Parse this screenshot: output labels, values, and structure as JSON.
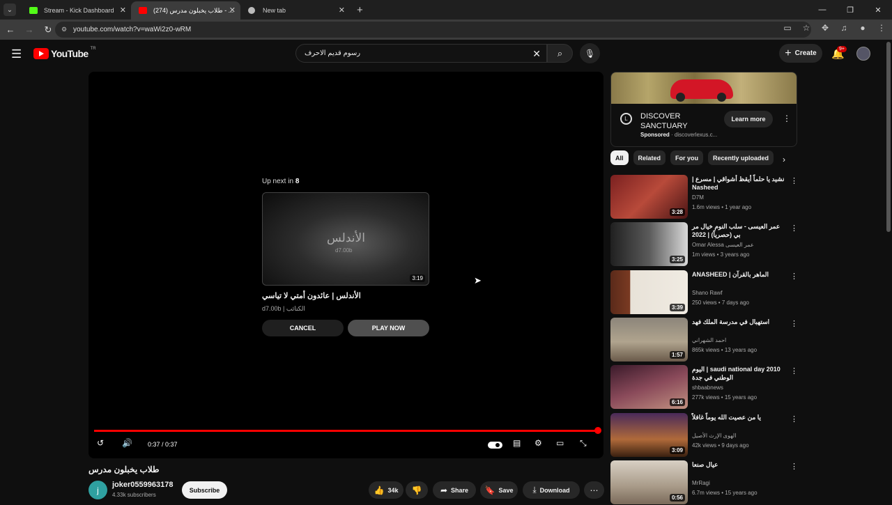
{
  "browser": {
    "tabs": [
      {
        "title": "Stream - Kick Dashboard",
        "fav_color": "#53fc18"
      },
      {
        "title": "طلاب يخبلون مدرس (274) - ...",
        "fav_color": "#ff0000"
      },
      {
        "title": "New tab",
        "fav_color": "#bbbbbb"
      }
    ],
    "url": "youtube.com/watch?v=waWi2z0-wRM"
  },
  "youtube": {
    "logo_text": "YouTube",
    "country": "TR",
    "search_value": "رسوم قديم الاحرف",
    "create_label": "Create",
    "notif_badge": "9+"
  },
  "player": {
    "upnext_prefix": "Up next in",
    "upnext_seconds": "8",
    "next_thumb_text": "الأندلس",
    "next_thumb_sub": "d7.00b",
    "next_duration": "3:19",
    "next_title": "الأندلس | عائدون أمتي لا تياسي",
    "next_channel": "d7.00b | الكتائب",
    "cancel_label": "CANCEL",
    "playnow_label": "PLAY NOW",
    "time": "0:37 / 0:37",
    "progress_fraction": 1.0
  },
  "video": {
    "title": "طلاب يخبلون مدرس",
    "channel_initial": "j",
    "channel": "joker0559963178",
    "subscribers": "4.33k subscribers",
    "subscribe_label": "Subscribe",
    "likes": "34k",
    "share_label": "Share",
    "save_label": "Save",
    "download_label": "Download"
  },
  "ad": {
    "title": "DISCOVER SANCTUARY",
    "sponsored": "Sponsored",
    "domain": "discoverlexus.c...",
    "learn_label": "Learn more"
  },
  "chips": [
    "All",
    "Related",
    "For you",
    "Recently uploaded"
  ],
  "recs": [
    {
      "title": "نشيد يا حلماً أيقظ أشواقي | مسرع | Nasheed",
      "channel": "D7M",
      "meta": "1.6m views • 1 year ago",
      "duration": "3:28",
      "thumb": "linear-gradient(135deg,#7a2020,#b84a3a 50%,#4a1515)"
    },
    {
      "title": "عمر العيسى - سلب النوم خيال مر بي (حصرياً) | 2022",
      "channel": "Omar Alessa عمر العيسى",
      "meta": "1m views • 3 years ago",
      "duration": "3:25",
      "thumb": "linear-gradient(90deg,#202020,#5a5a5a 50%,#d8d8d8)"
    },
    {
      "title": "الماهر بالقرآن | ANASHEED",
      "channel": "Shano Rawf",
      "meta": "250 views • 7 days ago",
      "duration": "3:39",
      "thumb": "linear-gradient(90deg,#5a2a1a 0%,#7a3a22 25%,#e8e2d8 26%,#f0ebe2 100%)"
    },
    {
      "title": "استهبال في مدرسة الملك فهد",
      "channel": "احمد الشهراني",
      "meta": "865k views • 13 years ago",
      "duration": "1:57",
      "thumb": "linear-gradient(180deg,#8c857a,#b0a48e 55%,#6a5a4a)"
    },
    {
      "title": "saudi national day 2010 | اليوم الوطني في جدة",
      "channel": "shbaabnews",
      "meta": "277k views • 15 years ago",
      "duration": "6:16",
      "thumb": "linear-gradient(160deg,#3a1a2a,#8a4a5a 50%,#c09080)"
    },
    {
      "title": "يا من عصيت الله يوماً غافلاً",
      "channel": "الهوى الإرث الأصيل",
      "meta": "42k views • 9 days ago",
      "duration": "3:09",
      "thumb": "linear-gradient(180deg,#4a2a5a,#b06a3a 60%,#3a2010)"
    },
    {
      "title": "عيال صنعا",
      "channel": "MrRagi",
      "meta": "6.7m views • 15 years ago",
      "duration": "0:56",
      "thumb": "linear-gradient(180deg,#d8d0c4,#a89a88 60%,#7a6a5a)"
    }
  ]
}
